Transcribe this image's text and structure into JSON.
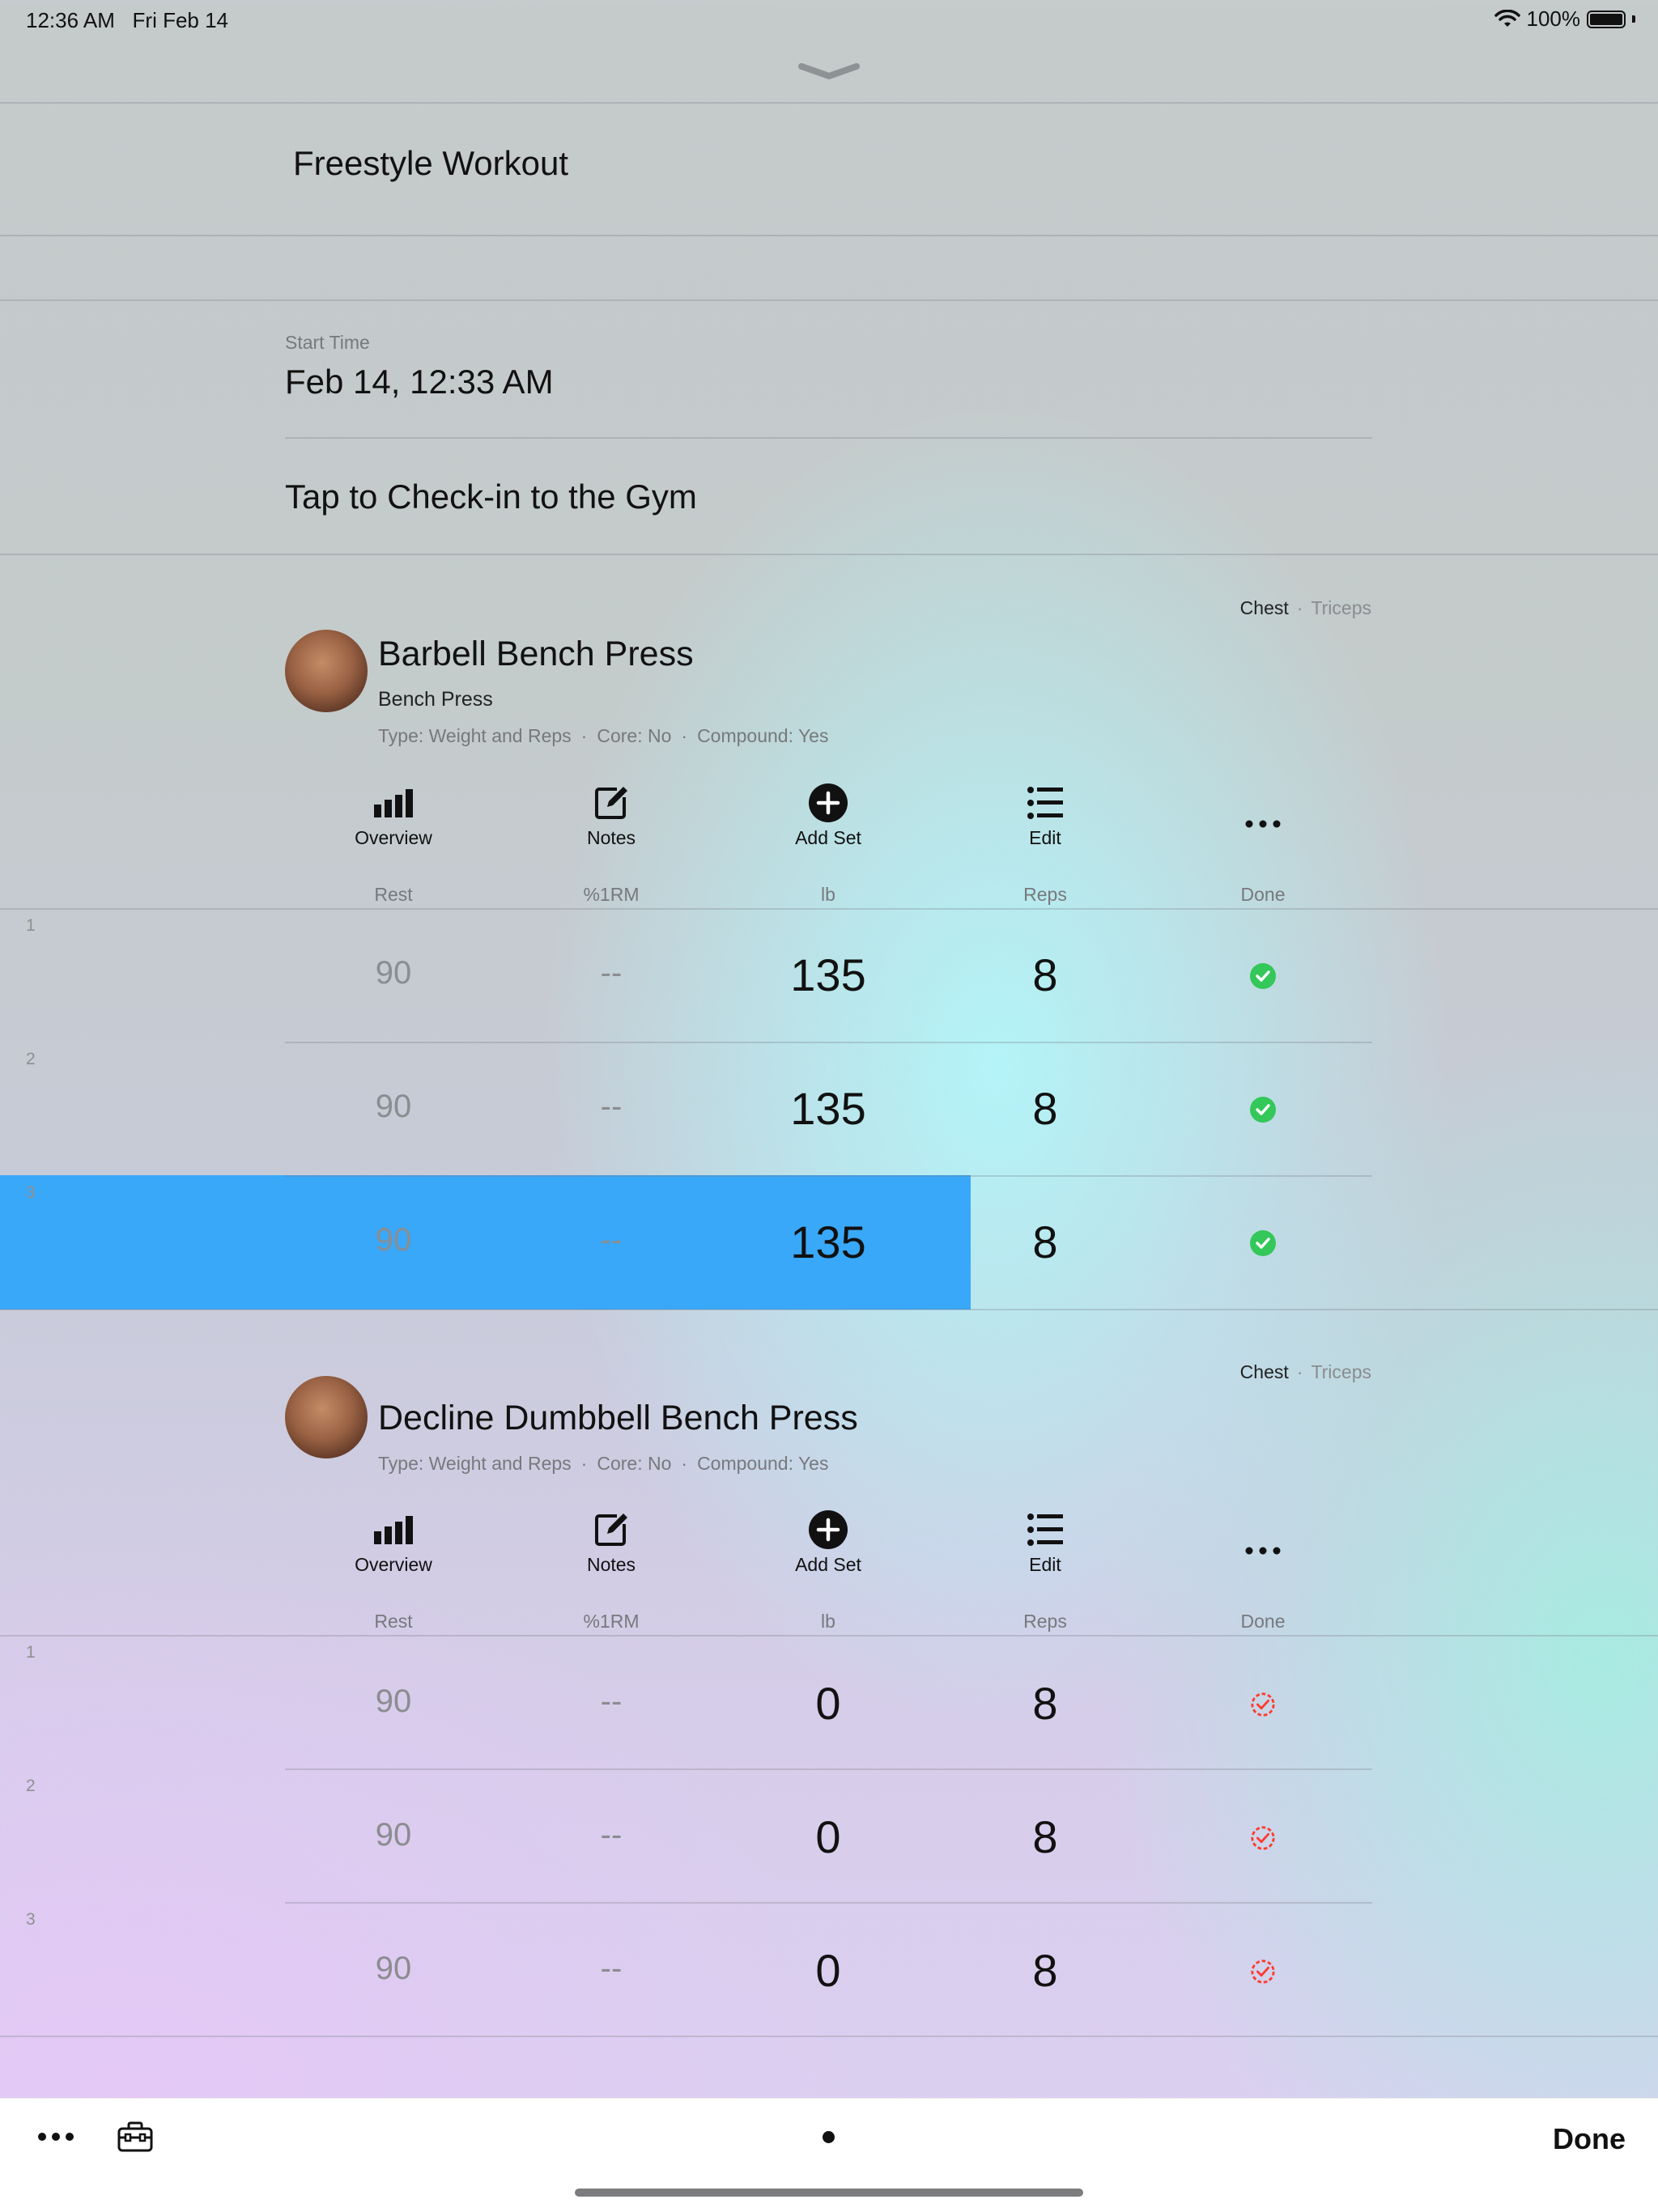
{
  "status": {
    "time": "12:36 AM",
    "date": "Fri Feb 14",
    "battery": "100%"
  },
  "workout": {
    "title": "Freestyle Workout",
    "start_label": "Start Time",
    "start_value": "Feb 14, 12:33 AM",
    "checkin": "Tap to Check-in to the Gym"
  },
  "toolbar_labels": {
    "overview": "Overview",
    "notes": "Notes",
    "add_set": "Add Set",
    "edit": "Edit"
  },
  "columns": {
    "rest": "Rest",
    "rm": "%1RM",
    "weight": "lb",
    "reps": "Reps",
    "done": "Done"
  },
  "exercises": [
    {
      "name": "Barbell Bench Press",
      "subtitle": "Bench Press",
      "type": "Type: Weight and Reps",
      "core": "Core: No",
      "compound": "Compound: Yes",
      "primary_muscle": "Chest",
      "secondary_muscle": "Triceps",
      "sets": [
        {
          "num": "1",
          "rest": "90",
          "rm": "--",
          "weight": "135",
          "reps": "8",
          "done": true
        },
        {
          "num": "2",
          "rest": "90",
          "rm": "--",
          "weight": "135",
          "reps": "8",
          "done": true
        },
        {
          "num": "3",
          "rest": "90",
          "rm": "--",
          "weight": "135",
          "reps": "8",
          "done": true
        }
      ]
    },
    {
      "name": "Decline Dumbbell Bench Press",
      "type": "Type: Weight and Reps",
      "core": "Core: No",
      "compound": "Compound: Yes",
      "primary_muscle": "Chest",
      "secondary_muscle": "Triceps",
      "sets": [
        {
          "num": "1",
          "rest": "90",
          "rm": "--",
          "weight": "0",
          "reps": "8",
          "done": false
        },
        {
          "num": "2",
          "rest": "90",
          "rm": "--",
          "weight": "0",
          "reps": "8",
          "done": false
        },
        {
          "num": "3",
          "rest": "90",
          "rm": "--",
          "weight": "0",
          "reps": "8",
          "done": false
        }
      ]
    }
  ],
  "bottom": {
    "done": "Done"
  },
  "colors": {
    "highlight": "#39a8f9",
    "done_green": "#34c759",
    "pending_red": "#ff3b30"
  }
}
